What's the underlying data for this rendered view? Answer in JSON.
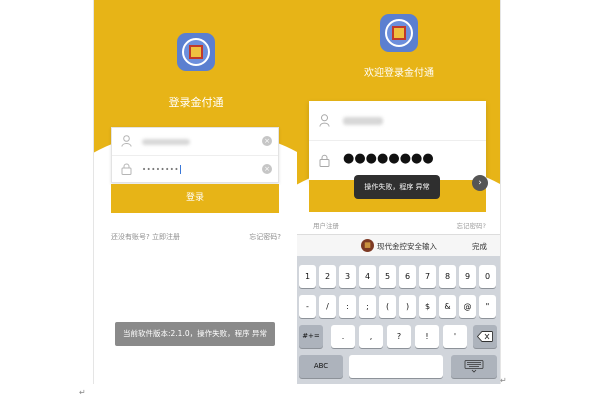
{
  "left_screen": {
    "title": "登录金付通",
    "password_mask": "••••••••",
    "login_button": "登录",
    "register_link": "还没有账号? 立即注册",
    "forgot_link": "忘记密码?",
    "toast": "当前软件版本:2.1.0，操作失败，程序 异常"
  },
  "right_screen": {
    "title": "欢迎登录金付通",
    "password_mask": "●●●●●●●●",
    "toast": "操作失败，程序 异常",
    "register_link": "用户注册",
    "forgot_link": "忘记密码?",
    "keyboard_header": {
      "title": "现代金控安全输入",
      "done": "完成"
    },
    "keyboard": {
      "row1": [
        "1",
        "2",
        "3",
        "4",
        "5",
        "6",
        "7",
        "8",
        "9",
        "0"
      ],
      "row2": [
        "-",
        "/",
        ":",
        ";",
        "(",
        ")",
        "$",
        "&",
        "@",
        "\""
      ],
      "switch_symbols": "#+=",
      "row3": [
        ".",
        ",",
        "?",
        "!",
        "'"
      ],
      "abc": "ABC"
    }
  },
  "colors": {
    "brand_yellow": "#e7b417",
    "toast_gray": "#8a8a8a",
    "toast_dark": "#2f2f2f"
  },
  "icons": [
    "user-icon",
    "lock-icon",
    "clear-icon",
    "chevron-right-icon",
    "backspace-icon",
    "keyboard-hide-icon",
    "app-logo-icon"
  ]
}
